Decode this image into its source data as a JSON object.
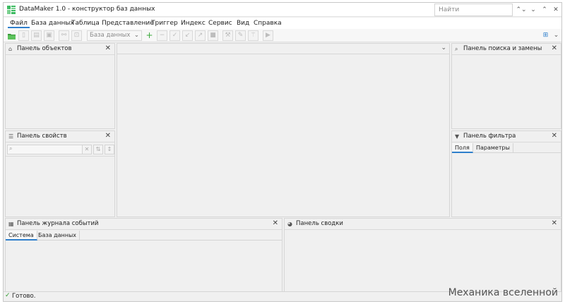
{
  "window": {
    "title": "DataMaker 1.0 - конструктор баз данных",
    "search_placeholder": "Найти",
    "controls": [
      "⌃⌄",
      "⌄",
      "⌃",
      "✕"
    ]
  },
  "menu": {
    "items": [
      "Файл",
      "База данных",
      "Таблица",
      "Представление",
      "Триггер",
      "Индекс",
      "Сервис",
      "Вид",
      "Справка"
    ],
    "active_index": 0
  },
  "toolbar": {
    "database_select": "База данных",
    "icons": [
      "open-folder-icon",
      "new-file-icon",
      "edit-icon",
      "save-icon",
      "link-icon",
      "lock-icon",
      "add-icon",
      "remove-icon",
      "check-icon",
      "arrow-down-left-icon",
      "arrow-up-right-icon",
      "stop-icon",
      "filter-edit-icon",
      "pencil-icon",
      "magic-icon",
      "play-icon"
    ]
  },
  "panels": {
    "objects": {
      "title": "Панель объектов"
    },
    "properties": {
      "title": "Панель свойств"
    },
    "search_replace": {
      "title": "Панель поиска и замены"
    },
    "filter": {
      "title": "Панель фильтра",
      "tabs": [
        "Поля",
        "Параметры"
      ]
    },
    "event_log": {
      "title": "Панель журнала событий",
      "tabs": [
        "Система",
        "База данных"
      ]
    },
    "summary": {
      "title": "Панель сводки"
    }
  },
  "status": {
    "text": "Готово."
  },
  "watermark": "Механика вселенной",
  "colors": {
    "accent": "#2e7fcc",
    "ok": "#2e9a2e",
    "brand_green": "#3dbb61"
  }
}
